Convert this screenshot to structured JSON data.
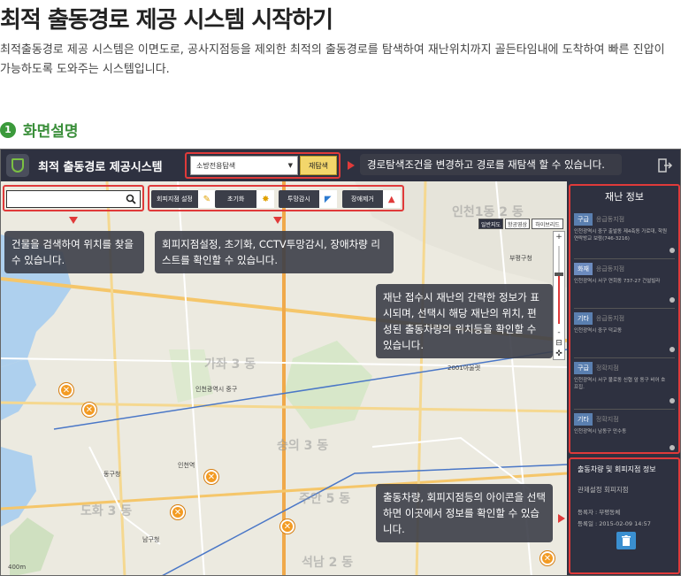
{
  "header": {
    "title": "최적 출동경로 제공 시스템 시작하기",
    "description": "최적출동경로 제공 시스템은 이면도로, 공사지점등을 제외한 최적의 출동경로를 탐색하여 재난위치까지 골든타임내에 도착하여 빠른 진압이 가능하도록 도와주는 시스템입니다."
  },
  "section": {
    "number": "1",
    "title": "화면설명"
  },
  "app": {
    "title": "최적 출동경로 제공시스템",
    "route_select_value": "소방전용탐색",
    "research_button": "재탐색",
    "logout_icon": "logout-icon"
  },
  "map": {
    "search_placeholder": "",
    "tools": [
      {
        "label": "회피지점 설정",
        "icon": "pencil-icon"
      },
      {
        "label": "초기화",
        "icon": "gear-icon"
      },
      {
        "label": "투망감시",
        "icon": "cctv-icon"
      },
      {
        "label": "장애제거",
        "icon": "warning-icon"
      }
    ],
    "map_types": [
      "일반지도",
      "항공영상",
      "하이브리드"
    ],
    "zoom_in": "+",
    "zoom_out": "-",
    "scale": "400m",
    "labels": {
      "chungcheon": "인천1동 2 동",
      "bupyeong": "부평구청",
      "station_junggu": "인천광역시 중구",
      "sungui": "숭의 3 동",
      "juan": "주안 5 동",
      "namgu": "남구청",
      "donggu": "동구청",
      "inchunstation": "인천역",
      "gajwa": "가좌 3 동",
      "dohwa": "도화 3 동",
      "seoknam": "석남 2 동",
      "2001": "2001아울렛"
    }
  },
  "callouts": {
    "search": "건물을 검색하여 위치를 찾을 수 있습니다.",
    "tools": "회피지점설정, 초기화, CCTV투망감시, 장애차량 리스트를 확인할 수 있습니다.",
    "route": "경로탐색조건을 변경하고 경로를 재탐색 할 수 있습니다.",
    "disaster": "재난 접수시 재난의 간략한 정보가 표시되며, 선택시 해당 재난의 위치, 편성된 출동차량의 위치등을 확인할 수 있습니다.",
    "vehicles": "출동차량, 회피지점등의 아이콘을 선택하면 이곳에서 정보를 확인할 수 있습니다."
  },
  "sidepanel": {
    "title": "재난 정보",
    "items": [
      {
        "badge": "구급",
        "type": "응급동지점",
        "address": "인천광역시 중구 출발동 제4축동 가로대, 학원연락방교 보람(746-3216)"
      },
      {
        "badge": "화재",
        "type": "응급동지점",
        "address": "인천광역시 서구 연회동 737-27 건설빌라"
      },
      {
        "badge": "기타",
        "type": "응급동지점",
        "address": "인천광역시 중구 덕교동"
      },
      {
        "badge": "구급",
        "type": "정확지점",
        "address": "인천광역시 서구 불로동 신협 앞 동구 비어 호프집."
      },
      {
        "badge": "기타",
        "type": "정확지점",
        "address": "인천광역시 남동구 만수동"
      }
    ]
  },
  "infopanel": {
    "title": "출동차량 및 회피지점 정보",
    "subtitle": "관제설정 회피지점",
    "registrant": "등록자 : 부평동체",
    "date": "등록일 : 2015-02-09 14:57"
  },
  "colors": {
    "accent": "#e03a3a",
    "topbar": "#2e3140",
    "green": "#3b9a3b",
    "marker": "#f39b23"
  }
}
